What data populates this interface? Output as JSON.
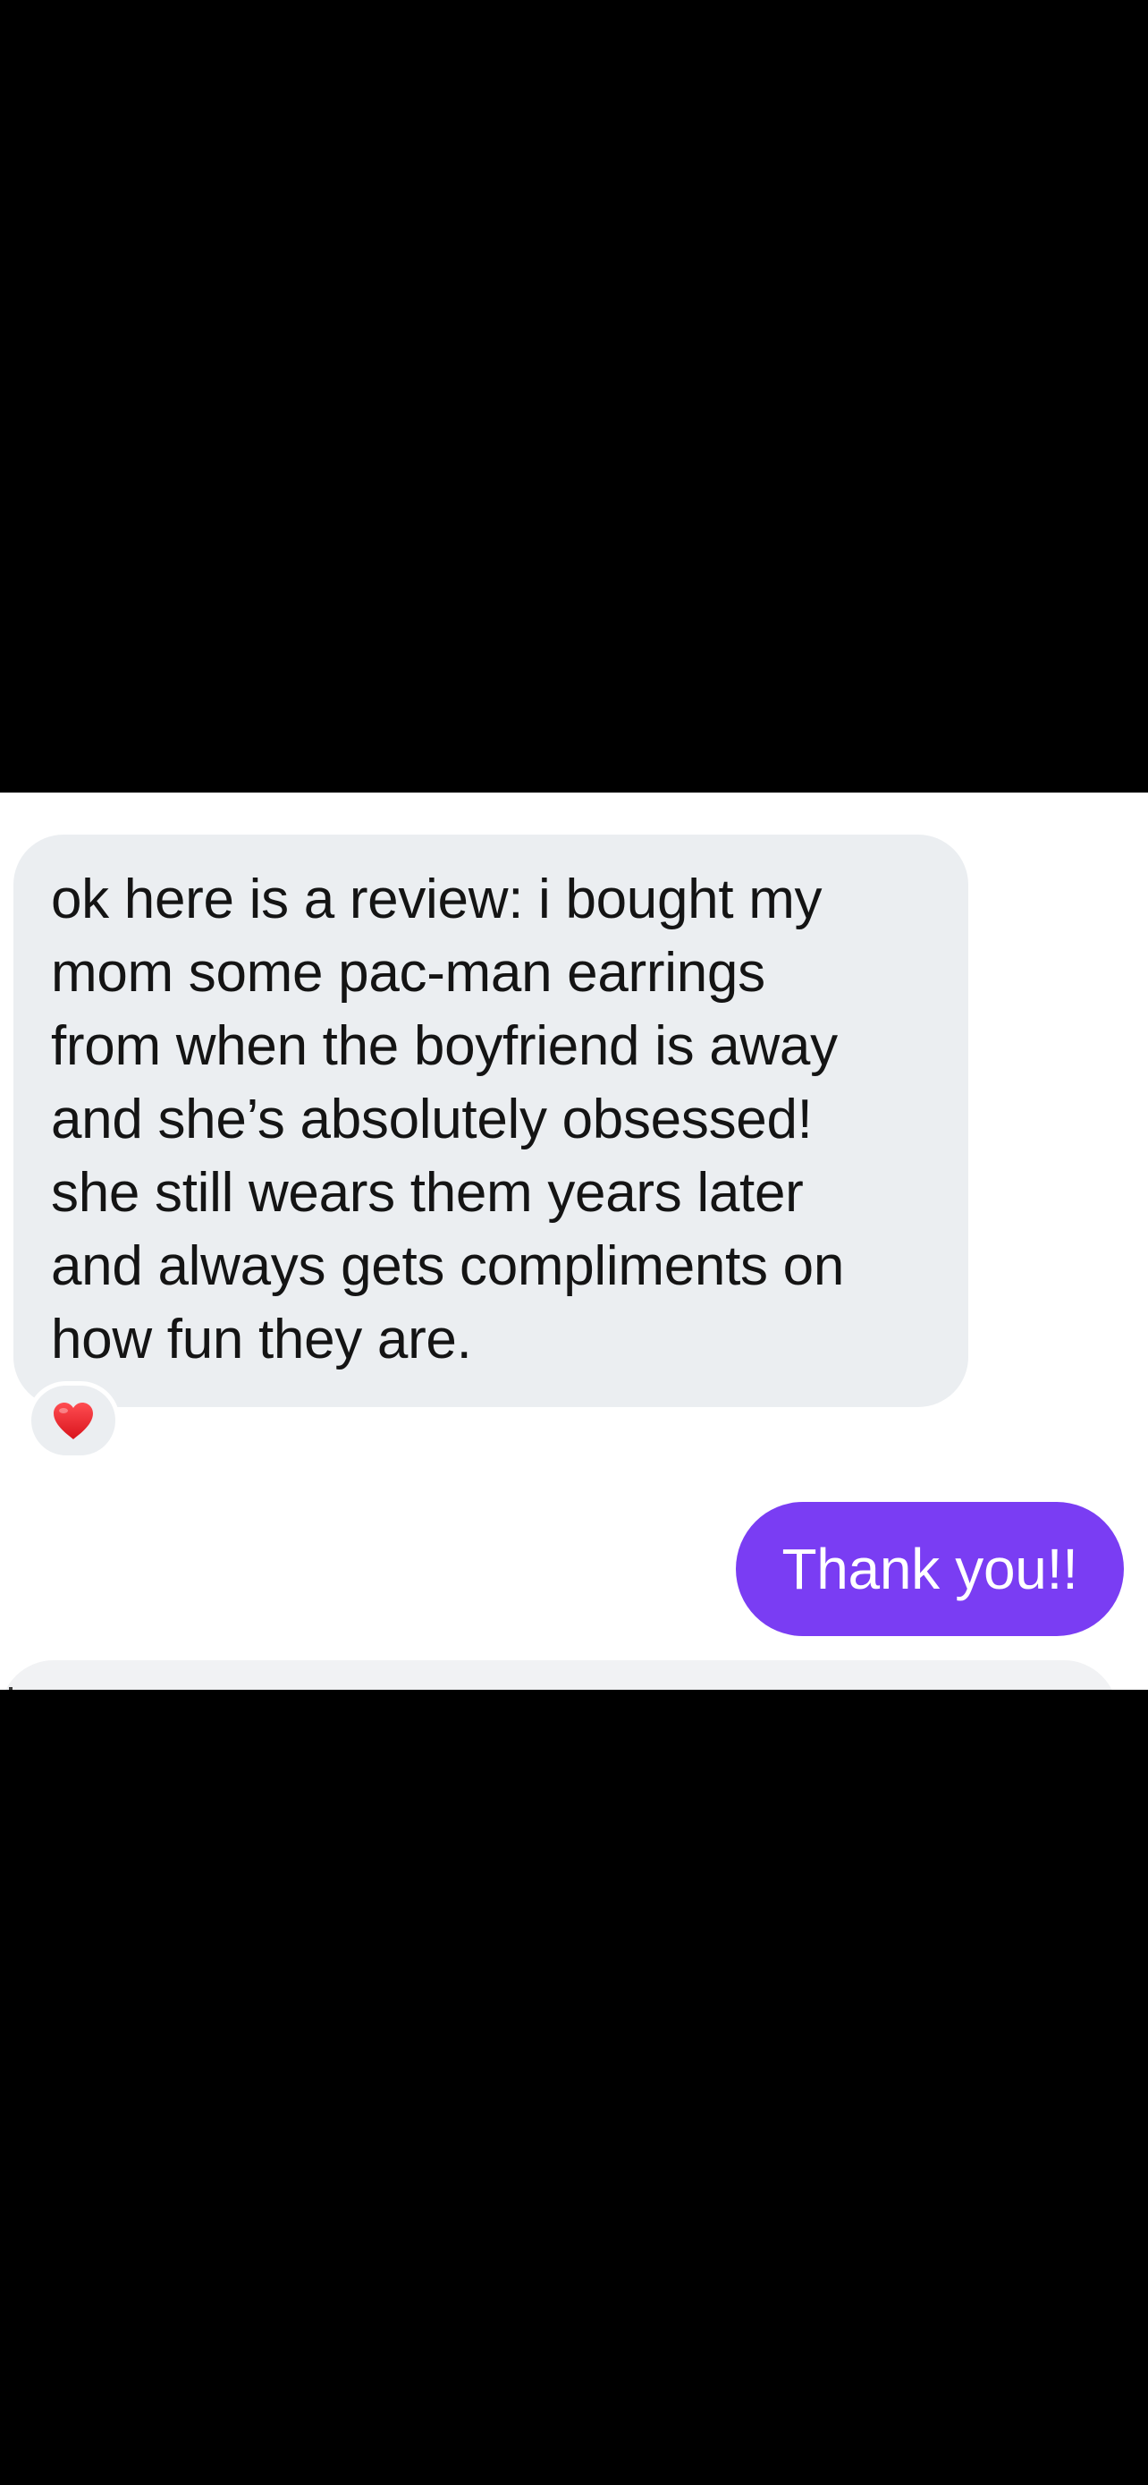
{
  "conversation": {
    "messages": [
      {
        "direction": "incoming",
        "text": "ok here is a review: i bought my\nmom some pac-man earrings\nfrom when the boyfriend is away\nand she’s absolutely obsessed!\nshe still wears them years later\nand always gets compliments on\nhow fun they are.",
        "reaction": "heart"
      },
      {
        "direction": "outgoing",
        "text": "Thank you!!"
      }
    ]
  },
  "colors": {
    "incoming_bubble": "#ebeef1",
    "outgoing_bubble": "#7a3df3",
    "reaction_heart": "#e8242b",
    "letterbox": "#000000"
  },
  "icons": {
    "reaction": "heart-icon"
  }
}
